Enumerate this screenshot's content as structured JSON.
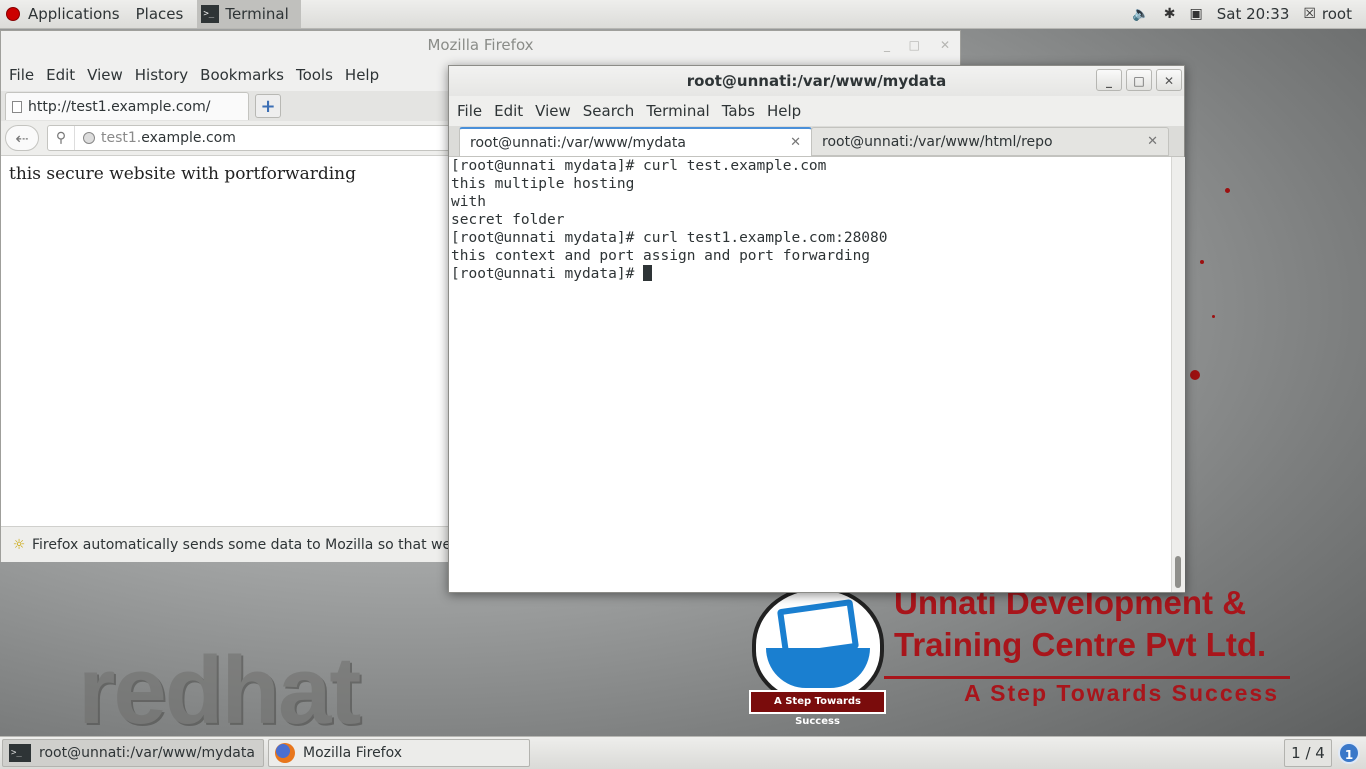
{
  "top_panel": {
    "applications": "Applications",
    "places": "Places",
    "active_window": "Terminal",
    "clock": "Sat 20:33",
    "user": "root"
  },
  "firefox": {
    "window_title": "Mozilla Firefox",
    "menu": [
      "File",
      "Edit",
      "View",
      "History",
      "Bookmarks",
      "Tools",
      "Help"
    ],
    "tab_title": "http://test1.example.com/",
    "new_tab": "+",
    "url_prefix": "test1.",
    "url_domain": "example.com",
    "page_text": "this secure website with portforwarding",
    "notification": "Firefox automatically sends some data to Mozilla so that we can"
  },
  "terminal": {
    "window_title": "root@unnati:/var/www/mydata",
    "menu": [
      "File",
      "Edit",
      "View",
      "Search",
      "Terminal",
      "Tabs",
      "Help"
    ],
    "tabs": [
      {
        "label": "root@unnati:/var/www/mydata"
      },
      {
        "label": "root@unnati:/var/www/html/repo"
      }
    ],
    "lines": [
      "[root@unnati mydata]# curl test.example.com",
      "this multiple hosting",
      "with",
      "secret folder",
      "[root@unnati mydata]# curl test1.example.com:28080",
      "this context and port assign and port forwarding",
      "[root@unnati mydata]# "
    ]
  },
  "desktop": {
    "company_line1": "Unnati Development &",
    "company_line2": "Training Centre Pvt Ltd.",
    "company_tagline": "A Step Towards Success",
    "logo_tagline": "A Step Towards Success",
    "watermark": "redhat"
  },
  "taskbar": {
    "items": [
      {
        "label": "root@unnati:/var/www/mydata"
      },
      {
        "label": "Mozilla Firefox"
      }
    ],
    "workspace": "1 / 4",
    "notifications": "1"
  },
  "colors": {
    "brand_red": "#a8151b",
    "logo_blue": "#1a7fd0",
    "tab_accent": "#4a90d9"
  },
  "icons": [
    "redhat-logo-icon",
    "terminal-icon",
    "volume-icon",
    "bluetooth-icon",
    "network-icon",
    "user-icon",
    "page-icon",
    "back-icon",
    "identity-icon",
    "globe-icon",
    "lightbulb-icon",
    "close-icon",
    "minimize-icon",
    "maximize-icon",
    "firefox-icon"
  ]
}
